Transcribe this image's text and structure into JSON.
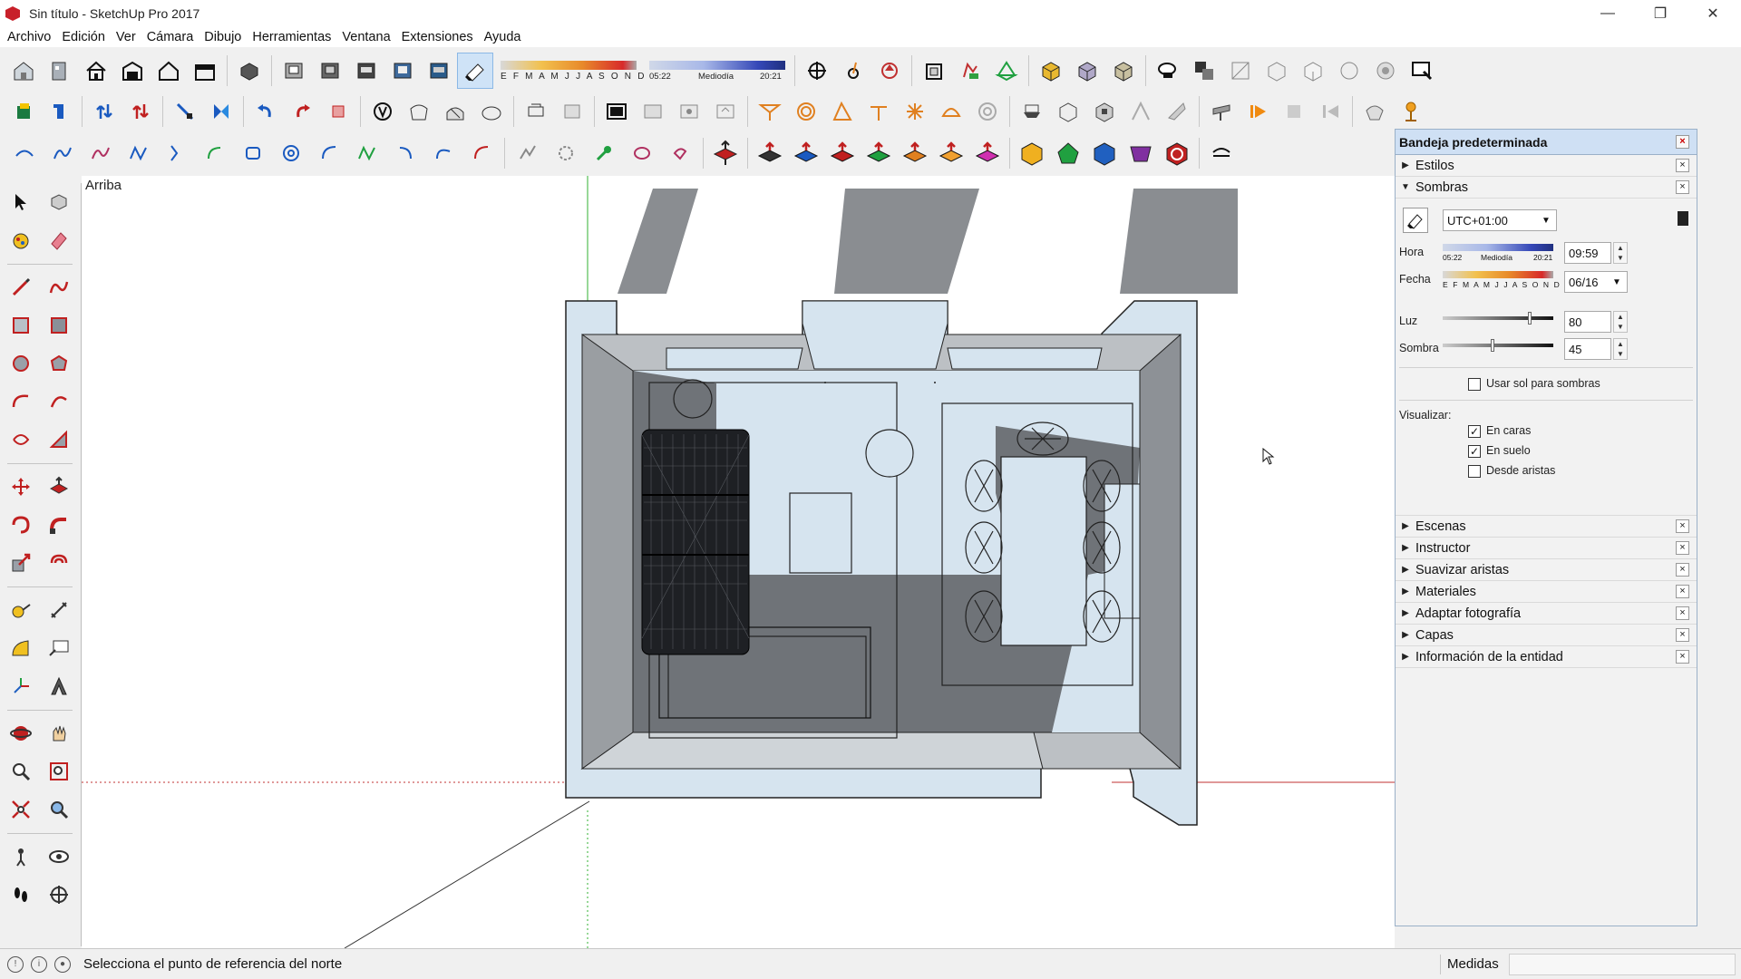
{
  "window": {
    "title": "Sin título - SketchUp Pro 2017",
    "minimize": "—",
    "maximize": "❐",
    "close": "✕"
  },
  "menu": [
    "Archivo",
    "Edición",
    "Ver",
    "Cámara",
    "Dibujo",
    "Herramientas",
    "Ventana",
    "Extensiones",
    "Ayuda"
  ],
  "toolbar_shadow_strip": {
    "months": "E F M A M J J A S O N D",
    "time_start": "05:22",
    "time_mid": "Mediodía",
    "time_end": "20:21"
  },
  "viewport": {
    "view_name": "Arriba"
  },
  "tray": {
    "title": "Bandeja predeterminada",
    "close": "×",
    "panels_top": [
      {
        "label": "Estilos",
        "expanded": false
      },
      {
        "label": "Sombras",
        "expanded": true
      }
    ],
    "sombras": {
      "timezone": "UTC+01:00",
      "hora_label": "Hora",
      "hora_start": "05:22",
      "hora_mid": "Mediodía",
      "hora_end": "20:21",
      "hora_value": "09:59",
      "fecha_label": "Fecha",
      "months": "E F M A M J J A S O N D",
      "fecha_value": "06/16",
      "luz_label": "Luz",
      "luz_value": "80",
      "luz_level": 0.8,
      "sombra_label": "Sombra",
      "sombra_value": "45",
      "sombra_level": 0.45,
      "use_sun": "Usar sol para sombras",
      "use_sun_checked": false,
      "visualizar_label": "Visualizar:",
      "en_caras": "En caras",
      "en_caras_checked": true,
      "en_suelo": "En suelo",
      "en_suelo_checked": true,
      "desde_aristas": "Desde aristas",
      "desde_aristas_checked": false
    },
    "panels_bottom": [
      {
        "label": "Escenas"
      },
      {
        "label": "Instructor"
      },
      {
        "label": "Suavizar aristas"
      },
      {
        "label": "Materiales"
      },
      {
        "label": "Adaptar fotografía"
      },
      {
        "label": "Capas"
      },
      {
        "label": "Información de la entidad"
      }
    ]
  },
  "status": {
    "message": "Selecciona el punto de referencia del norte",
    "measure_label": "Medidas",
    "measure_value": ""
  },
  "colors": {
    "accent": "#cfe0f4",
    "axis_red": "#c03030",
    "axis_green": "#30b030",
    "wall": "#d6e4ef",
    "shadow": "#6f7378"
  }
}
